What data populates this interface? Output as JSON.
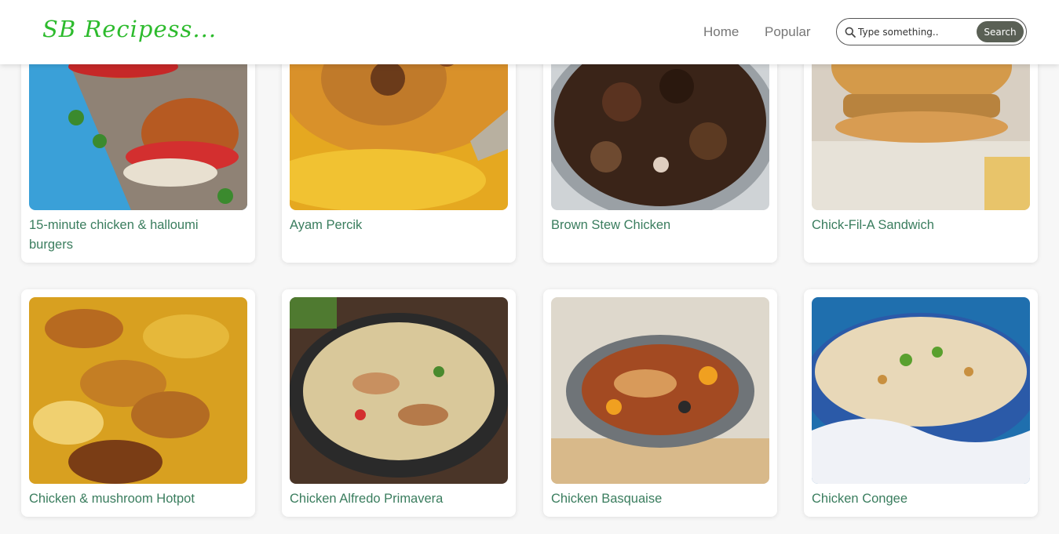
{
  "header": {
    "logo": "SB Recipess...",
    "nav": [
      {
        "label": "Home"
      },
      {
        "label": "Popular"
      }
    ],
    "search": {
      "placeholder": "Type something..",
      "button_label": "Search"
    }
  },
  "recipes": [
    {
      "title": "15-minute chicken & halloumi burgers",
      "image": "burgers-photo"
    },
    {
      "title": "Ayam Percik",
      "image": "grilled-chicken-photo"
    },
    {
      "title": "Brown Stew Chicken",
      "image": "stew-photo"
    },
    {
      "title": "Chick-Fil-A Sandwich",
      "image": "sandwich-photo"
    },
    {
      "title": "Chicken & mushroom Hotpot",
      "image": "hotpot-photo"
    },
    {
      "title": "Chicken Alfredo Primavera",
      "image": "pasta-photo"
    },
    {
      "title": "Chicken Basquaise",
      "image": "basquaise-photo"
    },
    {
      "title": "Chicken Congee",
      "image": "congee-photo"
    }
  ],
  "colors": {
    "logo": "#2dbb2d",
    "title": "#3a7d5e",
    "search_button": "#5a6055"
  }
}
